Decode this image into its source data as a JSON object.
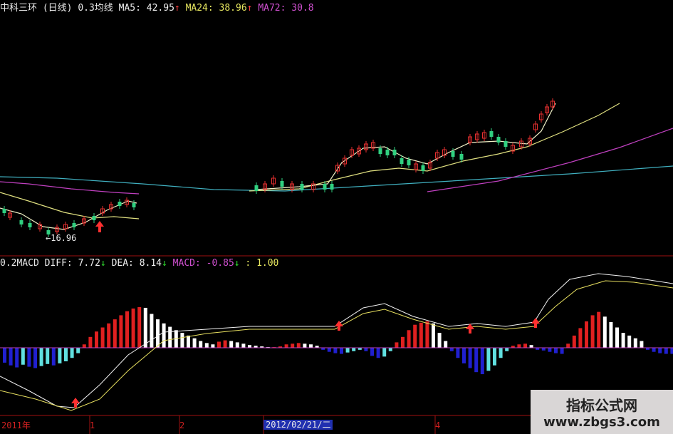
{
  "header": {
    "title": "中科三环 (日线)",
    "ma_label": "0.3均线",
    "ma5": "MA5: 42.95",
    "ma5_arrow": "↑",
    "ma24": "MA24: 38.96",
    "ma24_arrow": "↑",
    "ma72": "MA72: 30.8"
  },
  "macd_header": {
    "name": "0.2MACD",
    "diff": "DIFF: 7.72",
    "diff_arrow": "↓",
    "dea": "DEA: 8.14",
    "dea_arrow": "↓",
    "macd": "MACD: -0.85",
    "macd_arrow": "↓",
    "extra": ": 1.00"
  },
  "annotations": {
    "low_price": "←16.96"
  },
  "xaxis": {
    "year_label": "2011年",
    "tick_1": "1",
    "tick_2": "2",
    "cursor_date": "2012/02/21/二",
    "tick_4": "4"
  },
  "watermark": {
    "line1": "指标公式网",
    "line2": "www.zbgs3.com"
  },
  "colors": {
    "ma5": "#f2f2c8",
    "ma24": "#e0e080",
    "ma72": "#c040c0",
    "cyan_line": "#40b0c0",
    "up": "#e83030",
    "down": "#30d080",
    "hist_pos_rising": "#e02020",
    "hist_pos_falling": "#ffffff",
    "hist_neg_falling": "#2020d0",
    "hist_neg_rising": "#60e0e0",
    "panel_border": "#a01010",
    "axis_text": "#d02020"
  },
  "chart_data": [
    {
      "type": "candlestick",
      "title": "中科三环 (日线)",
      "lowest_marker": 16.96,
      "ma_latest": {
        "MA5": 42.95,
        "MA24": 38.96,
        "MA72": 30.8
      },
      "ylim": [
        10,
        48
      ]
    },
    {
      "type": "bar",
      "title": "0.2MACD",
      "latest": {
        "DIFF": 7.72,
        "DEA": 8.14,
        "MACD": -0.85
      },
      "series": [
        {
          "name": "MACD",
          "values": [
            -2.2,
            -2.6,
            -2.9,
            -2.5,
            -2.8,
            -3.0,
            -2.7,
            -2.4,
            -2.6,
            -2.3,
            -2.0,
            -1.5,
            -0.8,
            0.5,
            1.6,
            2.4,
            3.0,
            3.6,
            4.2,
            4.8,
            5.4,
            5.8,
            6.0,
            5.9,
            5.0,
            4.2,
            3.6,
            3.1,
            2.6,
            2.2,
            1.8,
            1.4,
            1.0,
            0.7,
            0.5,
            0.9,
            1.1,
            1.0,
            0.8,
            0.6,
            0.4,
            0.3,
            0.2,
            0.1,
            0.1,
            0.2,
            0.5,
            0.6,
            0.7,
            0.6,
            0.5,
            0.3,
            -0.3,
            -0.6,
            -0.8,
            -0.9,
            -0.7,
            -0.5,
            -0.3,
            -0.5,
            -1.2,
            -1.5,
            -1.3,
            -0.5,
            0.8,
            1.6,
            2.6,
            3.4,
            3.7,
            3.9,
            3.6,
            2.2,
            1.0,
            -0.5,
            -1.5,
            -2.3,
            -3.0,
            -3.6,
            -3.9,
            -3.4,
            -2.6,
            -1.5,
            -0.5,
            0.3,
            0.5,
            0.6,
            0.4,
            -0.3,
            -0.4,
            -0.6,
            -0.8,
            -0.9,
            0.6,
            1.8,
            2.9,
            3.9,
            4.8,
            5.3,
            4.6,
            3.8,
            3.0,
            2.2,
            1.8,
            1.4,
            1.0,
            -0.3,
            -0.6,
            -0.8,
            -0.9,
            -0.9,
            -0.85
          ]
        }
      ]
    }
  ]
}
